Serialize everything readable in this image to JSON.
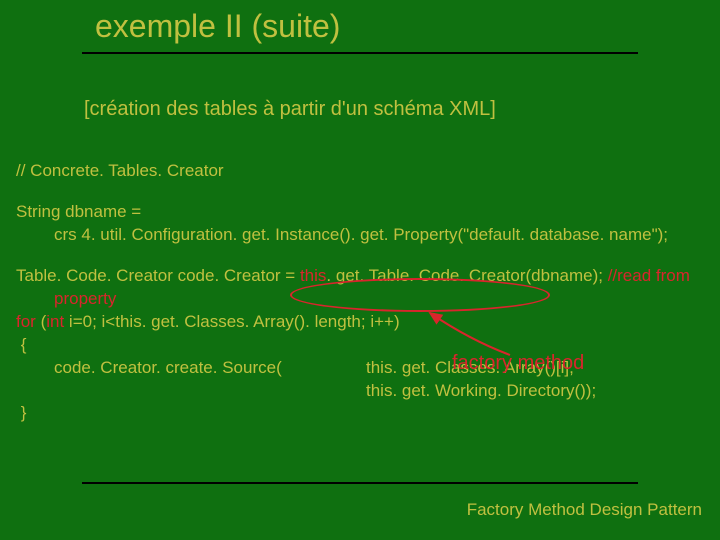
{
  "title": "exemple II (suite)",
  "subtitle": "[création des tables à partir d'un schéma XML]",
  "code": {
    "comment1": "// Concrete. Tables. Creator",
    "l1a": "String dbname =",
    "l1b": "crs 4. util. Configuration. get. Instance(). get. Property(\"default. database. name\");",
    "l2a": "Table. Code. Creator code. Creator = ",
    "l2b": "this",
    "l2c": ". get. Table. Code. Creator(dbname); ",
    "l2d": "//read from",
    "l2e": "property",
    "l3a": "for",
    "l3b": " (",
    "l3c": "int",
    "l3d": " i=0; i<this. get. Classes. Array(). length; i++)",
    "l4": " {",
    "l5a": "code. Creator. create. Source(",
    "l5b": "this. get. Classes. Array()[i],",
    "l6b": "this. get. Working. Directory());",
    "l7": " }"
  },
  "annotation": "factory method",
  "footer": "Factory Method Design Pattern"
}
